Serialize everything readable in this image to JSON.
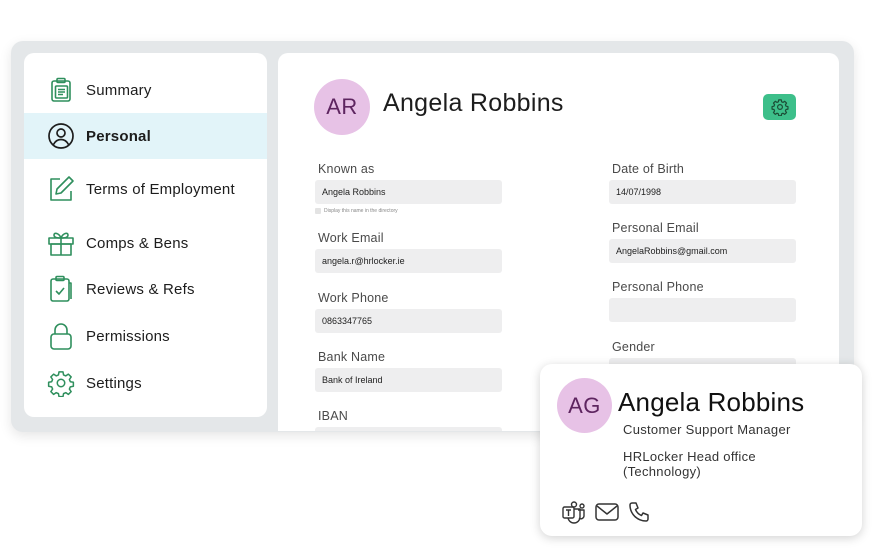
{
  "sidebar": {
    "items": [
      {
        "label": "Summary",
        "icon": "clipboard-icon"
      },
      {
        "label": "Personal",
        "icon": "user-circle-icon",
        "active": true
      },
      {
        "label": "Terms of Employment",
        "icon": "pencil-edit-icon"
      },
      {
        "label": "Comps & Bens",
        "icon": "gift-icon"
      },
      {
        "label": "Reviews & Refs",
        "icon": "clipboard-check-icon"
      },
      {
        "label": "Permissions",
        "icon": "lock-icon"
      },
      {
        "label": "Settings",
        "icon": "gear-icon"
      }
    ]
  },
  "header": {
    "initials": "AR",
    "name": "Angela Robbins",
    "settings_icon": "gear-icon"
  },
  "form": {
    "left": [
      {
        "label": "Known as",
        "value": "Angela Robbins"
      },
      {
        "label": "Work Email",
        "value": "angela.r@hrlocker.ie"
      },
      {
        "label": "Work Phone",
        "value": "0863347765"
      },
      {
        "label": "Bank Name",
        "value": "Bank of Ireland"
      },
      {
        "label": "IBAN",
        "value": ""
      }
    ],
    "right": [
      {
        "label": "Date of Birth",
        "value": "14/07/1998"
      },
      {
        "label": "Personal Email",
        "value": "AngelaRobbins@gmail.com"
      },
      {
        "label": "Personal Phone",
        "value": ""
      },
      {
        "label": "Gender",
        "value": ""
      }
    ],
    "known_as_hint": "Display this name in the directory"
  },
  "card": {
    "initials": "AG",
    "name": "Angela Robbins",
    "role": "Customer Support Manager",
    "office": "HRLocker Head office (Technology)",
    "icons": [
      "teams-icon",
      "mail-icon",
      "phone-icon"
    ]
  },
  "colors": {
    "accent_green": "#3dbf8a",
    "nav_icon_green": "#2f8f5d",
    "active_bg": "#e2f4f9",
    "avatar_bg": "#e7c2e6",
    "avatar_text": "#5e2560"
  }
}
